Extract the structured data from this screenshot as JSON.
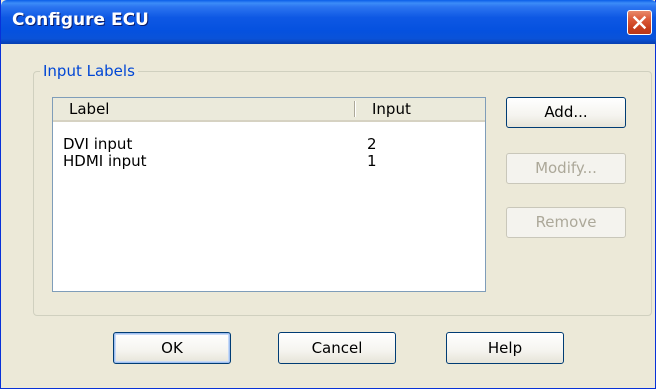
{
  "window": {
    "title": "Configure ECU",
    "close_icon": "close-x-icon"
  },
  "group": {
    "legend": "Input Labels"
  },
  "list": {
    "columns": [
      "Label",
      "Input"
    ],
    "rows": [
      {
        "label": "DVI input",
        "input": "2"
      },
      {
        "label": "HDMI input",
        "input": "1"
      }
    ]
  },
  "side_buttons": {
    "add": "Add...",
    "modify": "Modify...",
    "remove": "Remove"
  },
  "bottom_buttons": {
    "ok": "OK",
    "cancel": "Cancel",
    "help": "Help"
  },
  "colors": {
    "titlebar": "#0a52d8",
    "dialog_bg": "#ece9d8",
    "legend_text": "#0046d5",
    "close_button": "#dc5b3a",
    "disabled_text": "#aca899"
  }
}
